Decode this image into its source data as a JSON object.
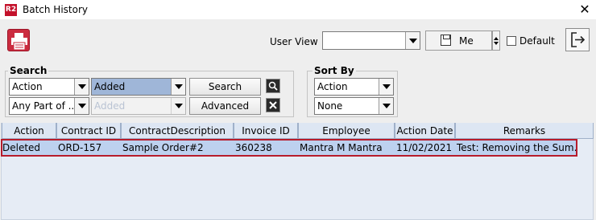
{
  "window": {
    "logo": "R2",
    "title": "Batch History",
    "close_icon": "close-icon"
  },
  "toolbar": {
    "print_icon": "printer-icon",
    "user_view_label": "User View",
    "user_view_value": "",
    "me_label": "Me",
    "default_label": "Default",
    "default_checked": false,
    "exit_icon": "exit-icon"
  },
  "search": {
    "title": "Search",
    "field_value": "Action",
    "value_selection": "Added",
    "match_mode": "Any Part of ...",
    "value_placeholder": "Added",
    "search_button": "Search",
    "advanced_button": "Advanced"
  },
  "sort": {
    "title": "Sort By",
    "primary": "Action",
    "secondary": "None"
  },
  "table": {
    "columns": [
      "Action",
      "Contract ID",
      "ContractDescription",
      "Invoice ID",
      "Employee",
      "Action Date",
      "Remarks"
    ],
    "rows": [
      [
        "Deleted",
        "ORD-157",
        "Sample Order#2",
        "360238",
        "Mantra M Mantra",
        "11/02/2021",
        "Test: Removing the Sum..."
      ]
    ]
  },
  "colors": {
    "brand": "#c4122b",
    "selection": "#bdd1ef",
    "highlight_border": "#b71c2c"
  }
}
